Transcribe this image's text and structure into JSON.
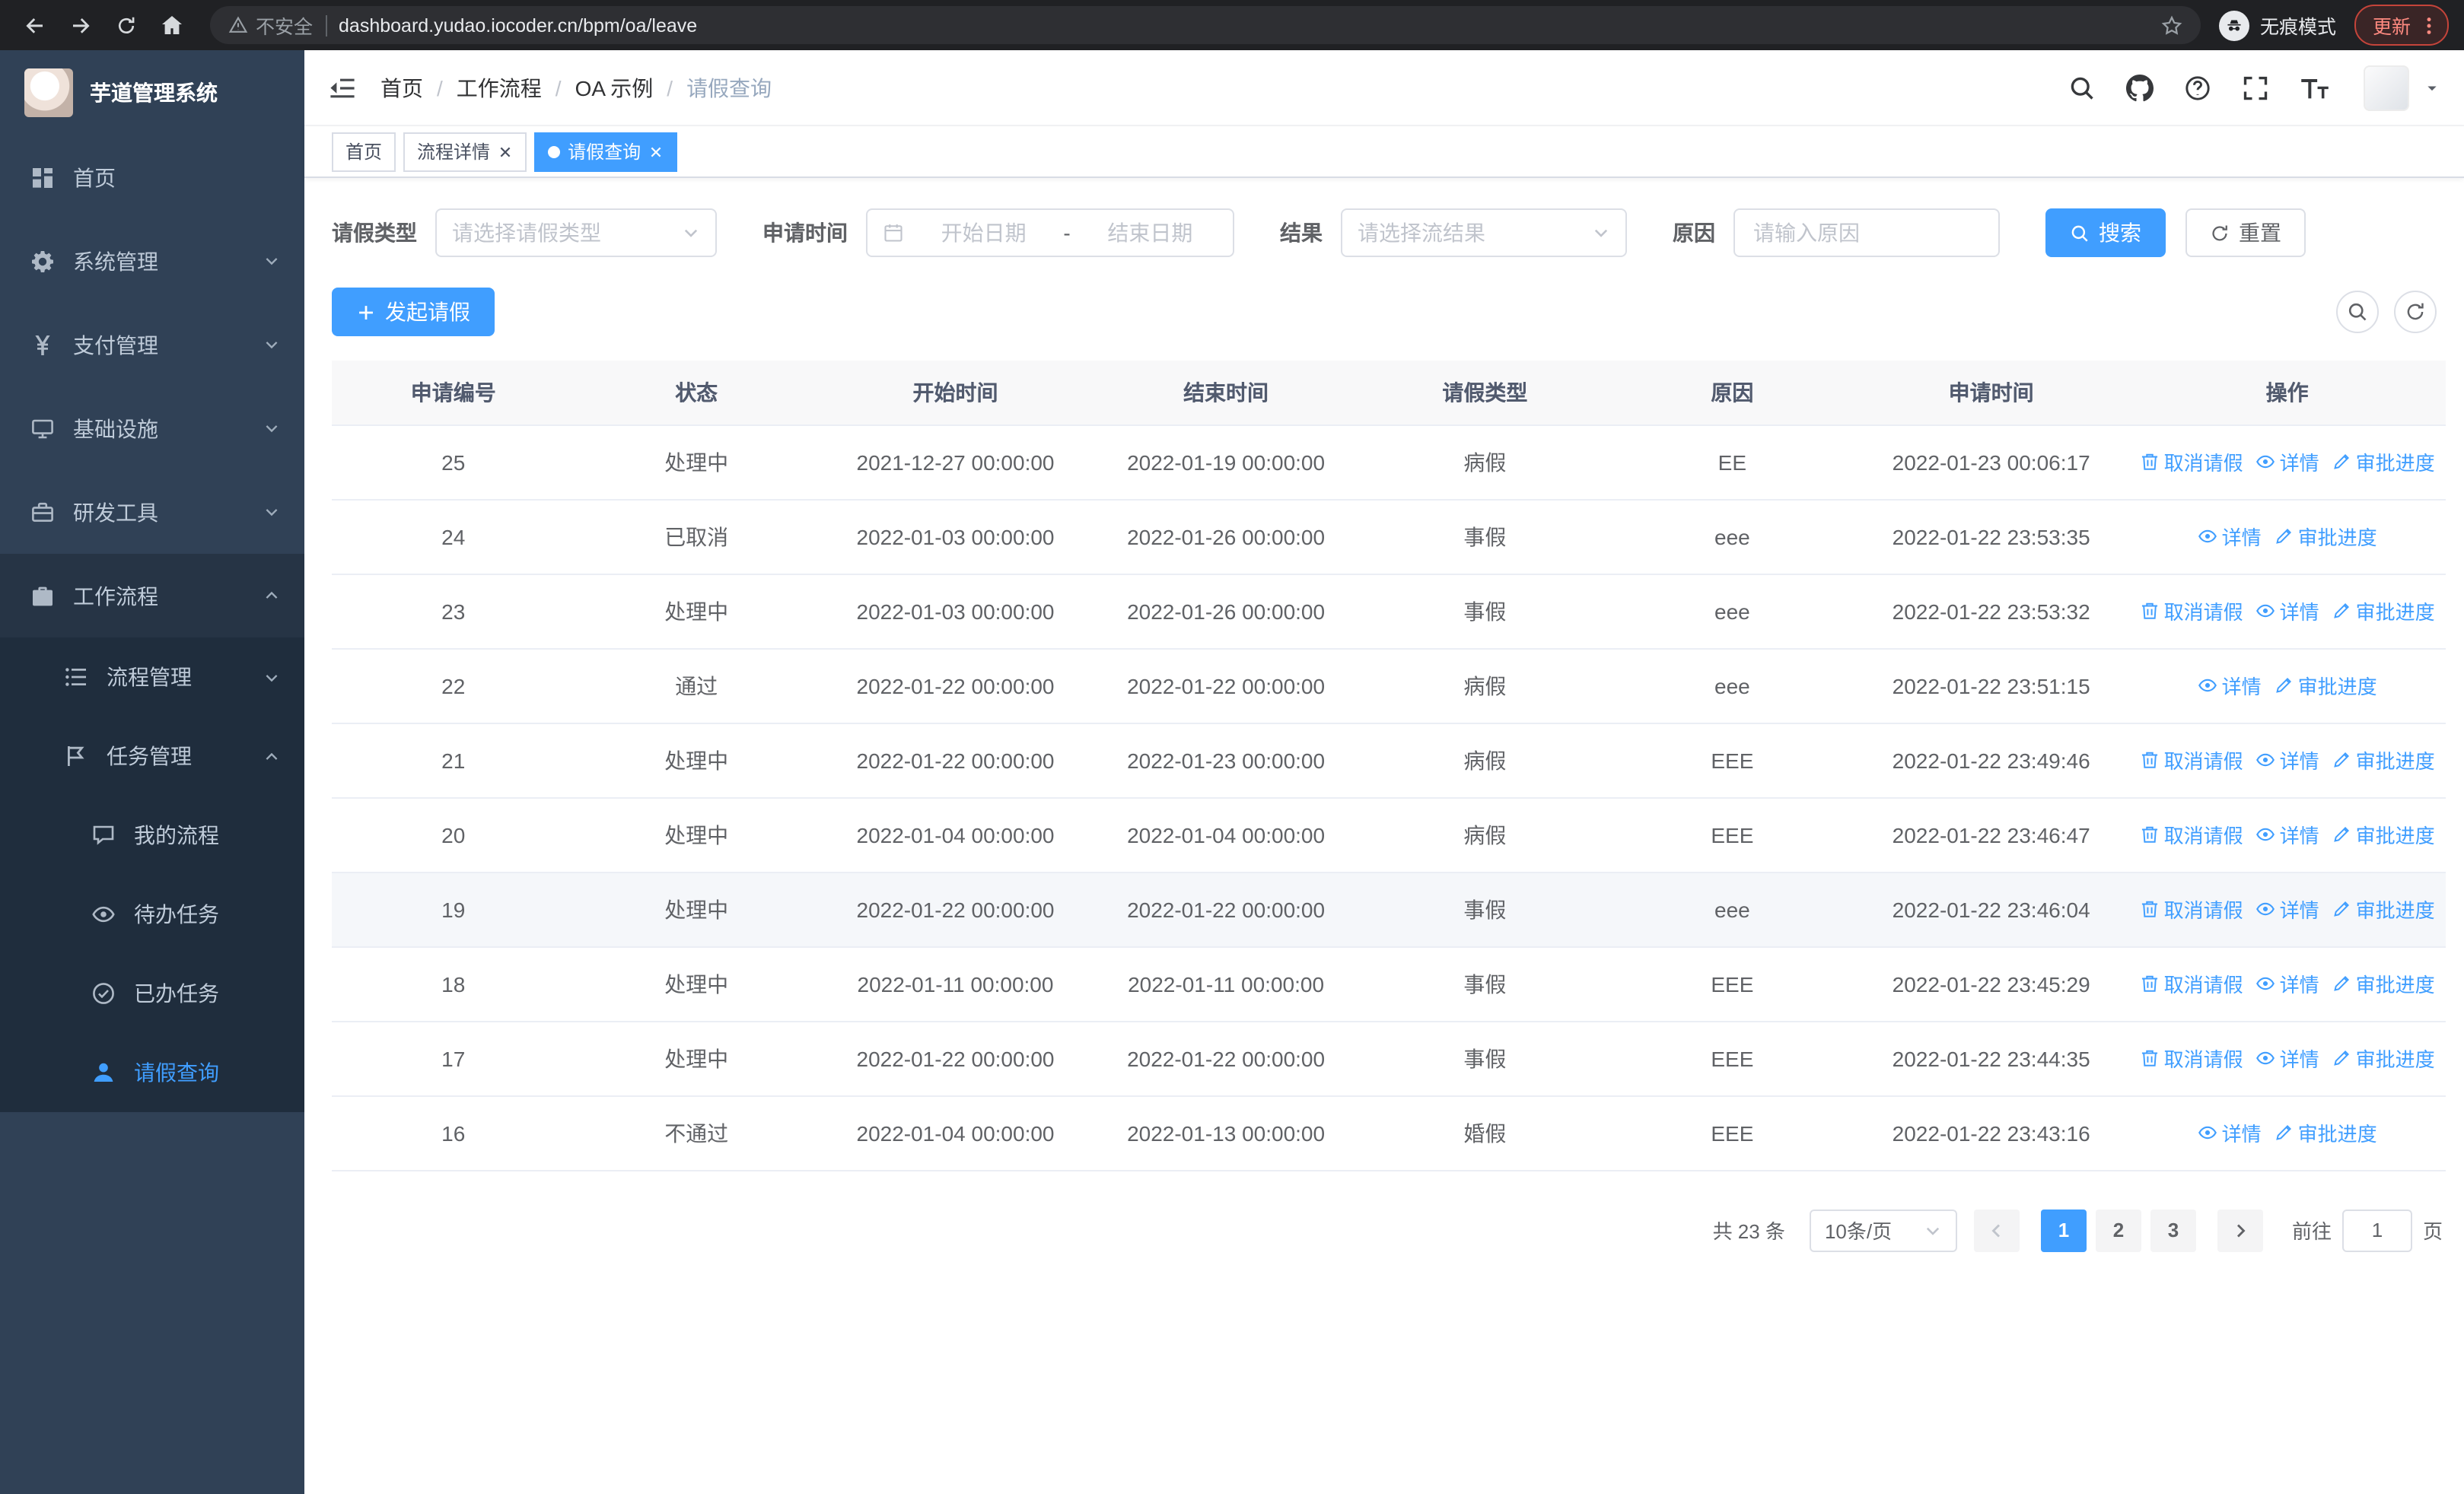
{
  "browser": {
    "security_label": "不安全",
    "url": "dashboard.yudao.iocoder.cn/bpm/oa/leave",
    "incognito_label": "无痕模式",
    "update_label": "更新"
  },
  "app": {
    "logo_title": "芋道管理系统"
  },
  "sidebar": {
    "items": [
      {
        "key": "home",
        "label": "首页",
        "icon": "dashboard-icon",
        "level": 1,
        "chevron": null,
        "active": false,
        "open": false
      },
      {
        "key": "system-management",
        "label": "系统管理",
        "icon": "gear-icon",
        "level": 1,
        "chevron": "down",
        "active": false,
        "open": false
      },
      {
        "key": "payment-management",
        "label": "支付管理",
        "icon": "yen-icon",
        "level": 1,
        "chevron": "down",
        "active": false,
        "open": false
      },
      {
        "key": "infrastructure",
        "label": "基础设施",
        "icon": "infrastructure-icon",
        "level": 1,
        "chevron": "down",
        "active": false,
        "open": false
      },
      {
        "key": "devtools",
        "label": "研发工具",
        "icon": "devtools-icon",
        "level": 1,
        "chevron": "down",
        "active": false,
        "open": false
      },
      {
        "key": "workflow",
        "label": "工作流程",
        "icon": "workflow-icon",
        "level": 1,
        "chevron": "up",
        "active": false,
        "open": true
      },
      {
        "key": "process-management",
        "label": "流程管理",
        "icon": "process-icon",
        "level": 2,
        "chevron": "down",
        "active": false,
        "open": false
      },
      {
        "key": "task-management",
        "label": "任务管理",
        "icon": "task-icon",
        "level": 2,
        "chevron": "up",
        "active": false,
        "open": false
      },
      {
        "key": "my-process",
        "label": "我的流程",
        "icon": "my-process-icon",
        "level": 3,
        "chevron": null,
        "active": false,
        "open": false
      },
      {
        "key": "todo-tasks",
        "label": "待办任务",
        "icon": "todo-icon",
        "level": 3,
        "chevron": null,
        "active": false,
        "open": false
      },
      {
        "key": "done-tasks",
        "label": "已办任务",
        "icon": "done-icon",
        "level": 3,
        "chevron": null,
        "active": false,
        "open": false
      },
      {
        "key": "leave-query",
        "label": "请假查询",
        "icon": "user-icon",
        "level": 3,
        "chevron": null,
        "active": true,
        "open": false
      }
    ]
  },
  "header": {
    "breadcrumb": [
      "首页",
      "工作流程",
      "OA 示例",
      "请假查询"
    ],
    "separator": "/"
  },
  "tabs": [
    {
      "label": "首页",
      "closable": false,
      "active": false
    },
    {
      "label": "流程详情",
      "closable": true,
      "active": false
    },
    {
      "label": "请假查询",
      "closable": true,
      "active": true
    }
  ],
  "filters": {
    "leave_type_label": "请假类型",
    "leave_type_placeholder": "请选择请假类型",
    "apply_time_label": "申请时间",
    "start_date_placeholder": "开始日期",
    "range_separator": "-",
    "end_date_placeholder": "结束日期",
    "result_label": "结果",
    "result_placeholder": "请选择流结果",
    "reason_label": "原因",
    "reason_placeholder": "请输入原因",
    "search_label": "搜索",
    "reset_label": "重置"
  },
  "toolbar": {
    "create_label": "发起请假"
  },
  "table": {
    "headers": [
      "申请编号",
      "状态",
      "开始时间",
      "结束时间",
      "请假类型",
      "原因",
      "申请时间",
      "操作"
    ],
    "actions": {
      "cancel": "取消请假",
      "detail": "详情",
      "progress": "审批进度"
    },
    "rows": [
      {
        "id": "25",
        "status": "处理中",
        "start": "2021-12-27 00:00:00",
        "end": "2022-01-19 00:00:00",
        "type": "病假",
        "reason": "EE",
        "apply_time": "2022-01-23 00:06:17",
        "cancellable": true,
        "hover": false
      },
      {
        "id": "24",
        "status": "已取消",
        "start": "2022-01-03 00:00:00",
        "end": "2022-01-26 00:00:00",
        "type": "事假",
        "reason": "eee",
        "apply_time": "2022-01-22 23:53:35",
        "cancellable": false,
        "hover": false
      },
      {
        "id": "23",
        "status": "处理中",
        "start": "2022-01-03 00:00:00",
        "end": "2022-01-26 00:00:00",
        "type": "事假",
        "reason": "eee",
        "apply_time": "2022-01-22 23:53:32",
        "cancellable": true,
        "hover": false
      },
      {
        "id": "22",
        "status": "通过",
        "start": "2022-01-22 00:00:00",
        "end": "2022-01-22 00:00:00",
        "type": "病假",
        "reason": "eee",
        "apply_time": "2022-01-22 23:51:15",
        "cancellable": false,
        "hover": false
      },
      {
        "id": "21",
        "status": "处理中",
        "start": "2022-01-22 00:00:00",
        "end": "2022-01-23 00:00:00",
        "type": "病假",
        "reason": "EEE",
        "apply_time": "2022-01-22 23:49:46",
        "cancellable": true,
        "hover": false
      },
      {
        "id": "20",
        "status": "处理中",
        "start": "2022-01-04 00:00:00",
        "end": "2022-01-04 00:00:00",
        "type": "病假",
        "reason": "EEE",
        "apply_time": "2022-01-22 23:46:47",
        "cancellable": true,
        "hover": false
      },
      {
        "id": "19",
        "status": "处理中",
        "start": "2022-01-22 00:00:00",
        "end": "2022-01-22 00:00:00",
        "type": "事假",
        "reason": "eee",
        "apply_time": "2022-01-22 23:46:04",
        "cancellable": true,
        "hover": true
      },
      {
        "id": "18",
        "status": "处理中",
        "start": "2022-01-11 00:00:00",
        "end": "2022-01-11 00:00:00",
        "type": "事假",
        "reason": "EEE",
        "apply_time": "2022-01-22 23:45:29",
        "cancellable": true,
        "hover": false
      },
      {
        "id": "17",
        "status": "处理中",
        "start": "2022-01-22 00:00:00",
        "end": "2022-01-22 00:00:00",
        "type": "事假",
        "reason": "EEE",
        "apply_time": "2022-01-22 23:44:35",
        "cancellable": true,
        "hover": false
      },
      {
        "id": "16",
        "status": "不通过",
        "start": "2022-01-04 00:00:00",
        "end": "2022-01-13 00:00:00",
        "type": "婚假",
        "reason": "EEE",
        "apply_time": "2022-01-22 23:43:16",
        "cancellable": false,
        "hover": false
      }
    ]
  },
  "pagination": {
    "total_label": "共 23 条",
    "page_size": "10条/页",
    "pages": [
      "1",
      "2",
      "3"
    ],
    "active_page": "1",
    "goto_label": "前往",
    "goto_value": "1",
    "goto_suffix": "页"
  },
  "colors": {
    "primary": "#409eff",
    "sidebar_bg": "#304156",
    "sidebar_sub_bg": "#1f2d3d",
    "danger": "#f56c6c"
  }
}
